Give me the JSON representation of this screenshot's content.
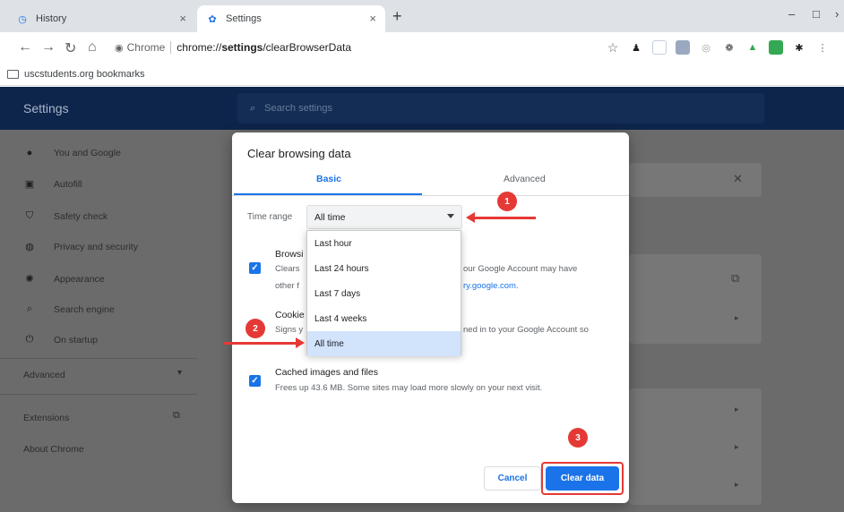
{
  "browser": {
    "tabs": [
      {
        "label": "History",
        "active": false
      },
      {
        "label": "Settings",
        "active": true
      }
    ],
    "tab_close_glyph": "×",
    "new_tab_glyph": "+",
    "window_controls": {
      "minimize": "–",
      "maximize": "□",
      "close": "›"
    },
    "omnibox": {
      "chip_label": "Chrome",
      "url_scheme": "chrome://",
      "url_bold": "settings",
      "url_rest": "/clearBrowserData"
    },
    "bookmarks_bar": {
      "folder_label": "uscstudents.org bookmarks"
    }
  },
  "settings": {
    "title": "Settings",
    "search_placeholder": "Search settings",
    "nav": [
      {
        "label": "You and Google",
        "icon": "person-icon"
      },
      {
        "label": "Autofill",
        "icon": "clipboard-icon"
      },
      {
        "label": "Safety check",
        "icon": "shield-icon"
      },
      {
        "label": "Privacy and security",
        "icon": "privacy-icon"
      },
      {
        "label": "Appearance",
        "icon": "palette-icon"
      },
      {
        "label": "Search engine",
        "icon": "search-icon"
      },
      {
        "label": "On startup",
        "icon": "power-icon"
      }
    ],
    "advanced_label": "Advanced",
    "extensions_label": "Extensions",
    "about_label": "About Chrome"
  },
  "dialog": {
    "title": "Clear browsing data",
    "tabs": {
      "basic": "Basic",
      "advanced": "Advanced"
    },
    "time_range_label": "Time range",
    "time_range_value": "All time",
    "options": [
      {
        "title": "Browsi",
        "desc_line1_left": "Clears",
        "desc_line1_right": "our Google Account may have",
        "desc_line2_left": "other f",
        "desc_line2_link": "ry.google.com."
      },
      {
        "title": "Cookie",
        "desc_line1_left": "Signs y",
        "desc_line1_right": "ned in to your Google Account so"
      },
      {
        "title": "Cached images and files",
        "desc_line1": "Frees up 43.6 MB. Some sites may load more slowly on your next visit."
      }
    ],
    "dropdown_options": [
      {
        "label": "Last hour",
        "selected": false
      },
      {
        "label": "Last 24 hours",
        "selected": false
      },
      {
        "label": "Last 7 days",
        "selected": false
      },
      {
        "label": "Last 4 weeks",
        "selected": false
      },
      {
        "label": "All time",
        "selected": true
      }
    ],
    "cancel_label": "Cancel",
    "clear_label": "Clear data"
  },
  "annotations": {
    "badges": [
      "1",
      "2",
      "3"
    ],
    "color": "#e53935"
  },
  "colors": {
    "accent": "#1a73e8",
    "settings_header": "#0e254b",
    "dim_overlay": "#6b6b6b"
  }
}
